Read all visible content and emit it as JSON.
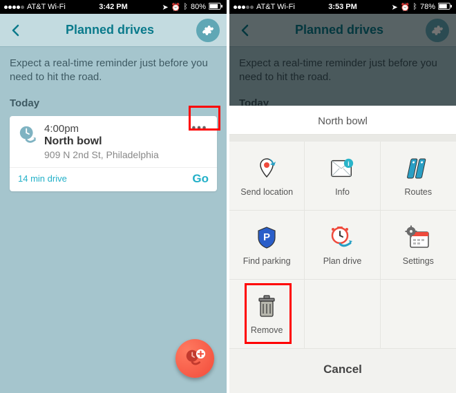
{
  "left": {
    "status": {
      "carrier": "AT&T Wi-Fi",
      "time": "3:42 PM",
      "battery": "80%"
    },
    "header": {
      "title": "Planned drives"
    },
    "subtitle": "Expect a real-time reminder just before you need to hit the road.",
    "section_label": "Today",
    "drive": {
      "time": "4:00pm",
      "title": "North bowl",
      "address": "909 N 2nd St, Philadelphia",
      "eta": "14 min drive",
      "go": "Go",
      "more": "•••"
    }
  },
  "right": {
    "status": {
      "carrier": "AT&T Wi-Fi",
      "time": "3:53 PM",
      "battery": "78%"
    },
    "header": {
      "title": "Planned drives"
    },
    "subtitle": "Expect a real-time reminder just before you need to hit the road.",
    "section_label": "Today",
    "sheet": {
      "title": "North bowl",
      "items": [
        {
          "label": "Send location"
        },
        {
          "label": "Info"
        },
        {
          "label": "Routes"
        },
        {
          "label": "Find parking"
        },
        {
          "label": "Plan drive"
        },
        {
          "label": "Settings"
        },
        {
          "label": "Remove"
        }
      ],
      "cancel": "Cancel"
    }
  },
  "icons": {
    "back": "chevron-left-icon",
    "gear": "gear-icon",
    "clock": "clock-drive-icon",
    "more": "more-icon",
    "fab": "add-planned-drive-icon"
  }
}
